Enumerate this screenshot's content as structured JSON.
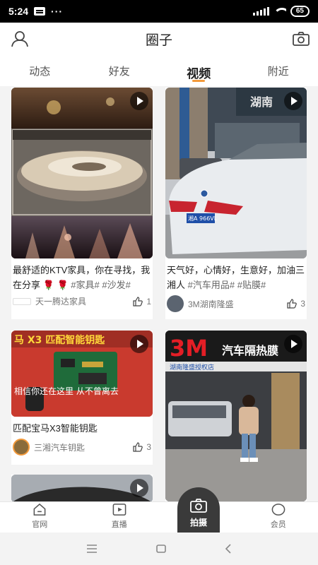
{
  "status": {
    "time": "5:24",
    "battery": "65"
  },
  "header": {
    "title": "圈子",
    "profile_icon": "user-icon",
    "camera_icon": "camera-icon"
  },
  "tabs": [
    {
      "label": "动态"
    },
    {
      "label": "好友"
    },
    {
      "label": "视频",
      "active": true
    },
    {
      "label": "附近"
    }
  ],
  "feed": {
    "cards": [
      {
        "caption": "最舒适的KTV家具，你在寻找，我在分享",
        "emoji": "🌹 🌹",
        "tags": "#家具# #沙发#",
        "author": "天一腾达家具",
        "likes": "1"
      },
      {
        "caption": "天气好，心情好，生意好，加油三湘人",
        "tags": "#汽车用品# #贴膜#",
        "author": "3M湖南隆盛",
        "likes": "3",
        "plate": "湘A 966VL",
        "sign": "湖南"
      },
      {
        "caption": "匹配宝马X3智能钥匙",
        "tags": "",
        "author": "三湘汽车钥匙",
        "likes": "3",
        "overlay_top": "马 X3 匹配智能钥匙",
        "overlay_bottom": "相信你还在这里 从不曾离去"
      },
      {
        "caption": "",
        "tags": "",
        "author": "",
        "likes": "",
        "sign_big": "3M",
        "sign_text": "汽车隔热膜",
        "sign_sub": "湖南隆盛授权店"
      }
    ]
  },
  "bottom_nav": [
    {
      "label": "官网",
      "icon": "home-icon"
    },
    {
      "label": "直播",
      "icon": "live-icon"
    },
    {
      "label": "拍摄",
      "icon": "camera-icon"
    },
    {
      "label": "会员",
      "icon": "member-icon"
    }
  ],
  "colors": {
    "accent": "#f39a3b",
    "shoot_bg": "#3a3a3a"
  }
}
